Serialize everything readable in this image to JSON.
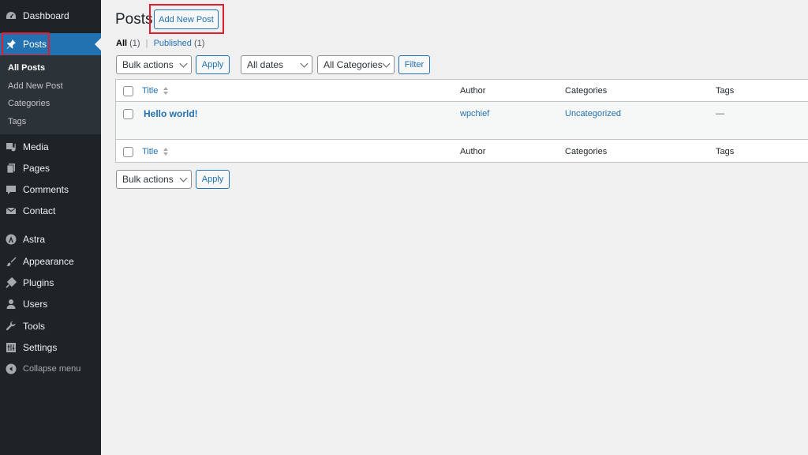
{
  "sidebar": {
    "items": [
      {
        "label": "Dashboard",
        "icon": "dashboard-icon"
      },
      {
        "label": "Posts",
        "icon": "pin-icon"
      },
      {
        "label": "Media",
        "icon": "media-icon"
      },
      {
        "label": "Pages",
        "icon": "pages-icon"
      },
      {
        "label": "Comments",
        "icon": "comments-icon"
      },
      {
        "label": "Contact",
        "icon": "mail-icon"
      },
      {
        "label": "Astra",
        "icon": "astra-icon"
      },
      {
        "label": "Appearance",
        "icon": "brush-icon"
      },
      {
        "label": "Plugins",
        "icon": "plugin-icon"
      },
      {
        "label": "Users",
        "icon": "user-icon"
      },
      {
        "label": "Tools",
        "icon": "wrench-icon"
      },
      {
        "label": "Settings",
        "icon": "settings-icon"
      },
      {
        "label": "Collapse menu",
        "icon": "collapse-icon"
      }
    ],
    "submenu": [
      "All Posts",
      "Add New Post",
      "Categories",
      "Tags"
    ]
  },
  "page": {
    "title": "Posts",
    "add_new_label": "Add New Post"
  },
  "views": {
    "all_label": "All",
    "all_count": "(1)",
    "separator": "|",
    "published_label": "Published",
    "published_count": "(1)"
  },
  "filters": {
    "bulk_actions": "Bulk actions",
    "apply": "Apply",
    "dates": "All dates",
    "categories": "All Categories",
    "filter": "Filter"
  },
  "table": {
    "columns": [
      "Title",
      "Author",
      "Categories",
      "Tags"
    ],
    "rows": [
      {
        "title": "Hello world!",
        "author": "wpchief",
        "categories": "Uncategorized",
        "tags": "—"
      }
    ]
  },
  "colors": {
    "sidebar_bg": "#1d2327",
    "accent": "#2271b1",
    "highlight": "#e11d2e"
  }
}
